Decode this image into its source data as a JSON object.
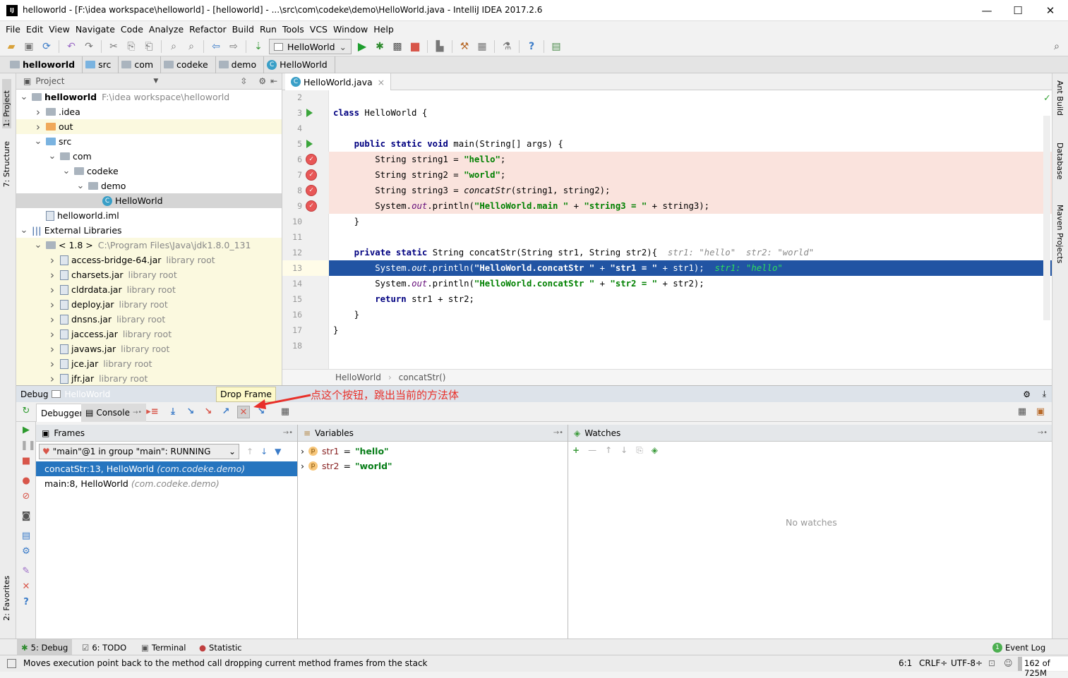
{
  "window": {
    "title": "helloworld - [F:\\idea workspace\\helloworld] - [helloworld] - ...\\src\\com\\codeke\\demo\\HelloWorld.java - IntelliJ IDEA 2017.2.6",
    "logo": "IJ",
    "minimize": "—",
    "maximize": "☐",
    "close": "✕"
  },
  "menu": [
    "File",
    "Edit",
    "View",
    "Navigate",
    "Code",
    "Analyze",
    "Refactor",
    "Build",
    "Run",
    "Tools",
    "VCS",
    "Window",
    "Help"
  ],
  "toolbar": {
    "run_config": "HelloWorld"
  },
  "breadcrumb": [
    "helloworld",
    "src",
    "com",
    "codeke",
    "demo",
    "HelloWorld"
  ],
  "left_tabs": {
    "project": "1: Project",
    "structure": "7: Structure",
    "favorites": "2: Favorites"
  },
  "right_tabs": {
    "ant": "Ant Build",
    "database": "Database",
    "maven": "Maven Projects"
  },
  "project": {
    "title": "Project",
    "tree": [
      {
        "level": 0,
        "arrow": "open",
        "icon": "module",
        "label": "helloworld",
        "secondary": "F:\\idea workspace\\helloworld",
        "bold": true
      },
      {
        "level": 1,
        "arrow": "closed",
        "icon": "folder",
        "label": ".idea"
      },
      {
        "level": 1,
        "arrow": "closed",
        "icon": "folder-orange",
        "label": "out",
        "excluded": true
      },
      {
        "level": 1,
        "arrow": "open",
        "icon": "folder-blue",
        "label": "src"
      },
      {
        "level": 2,
        "arrow": "open",
        "icon": "package",
        "label": "com"
      },
      {
        "level": 3,
        "arrow": "open",
        "icon": "package",
        "label": "codeke"
      },
      {
        "level": 4,
        "arrow": "open",
        "icon": "package",
        "label": "demo"
      },
      {
        "level": 5,
        "arrow": "",
        "icon": "class",
        "label": "HelloWorld",
        "selected": true
      },
      {
        "level": 1,
        "arrow": "",
        "icon": "iml",
        "label": "helloworld.iml"
      },
      {
        "level": 0,
        "arrow": "open",
        "icon": "libraries",
        "label": "External Libraries"
      },
      {
        "level": 1,
        "arrow": "open",
        "icon": "jdk",
        "label": "< 1.8 >",
        "secondary": "C:\\Program Files\\Java\\jdk1.8.0_131",
        "excluded": true
      },
      {
        "level": 2,
        "arrow": "closed",
        "icon": "jar",
        "label": "access-bridge-64.jar",
        "secondary": "library root",
        "excluded": true
      },
      {
        "level": 2,
        "arrow": "closed",
        "icon": "jar",
        "label": "charsets.jar",
        "secondary": "library root",
        "excluded": true
      },
      {
        "level": 2,
        "arrow": "closed",
        "icon": "jar",
        "label": "cldrdata.jar",
        "secondary": "library root",
        "excluded": true
      },
      {
        "level": 2,
        "arrow": "closed",
        "icon": "jar",
        "label": "deploy.jar",
        "secondary": "library root",
        "excluded": true
      },
      {
        "level": 2,
        "arrow": "closed",
        "icon": "jar",
        "label": "dnsns.jar",
        "secondary": "library root",
        "excluded": true
      },
      {
        "level": 2,
        "arrow": "closed",
        "icon": "jar",
        "label": "jaccess.jar",
        "secondary": "library root",
        "excluded": true
      },
      {
        "level": 2,
        "arrow": "closed",
        "icon": "jar",
        "label": "javaws.jar",
        "secondary": "library root",
        "excluded": true
      },
      {
        "level": 2,
        "arrow": "closed",
        "icon": "jar",
        "label": "jce.jar",
        "secondary": "library root",
        "excluded": true
      },
      {
        "level": 2,
        "arrow": "closed",
        "icon": "jar",
        "label": "jfr.jar",
        "secondary": "library root",
        "excluded": true
      }
    ]
  },
  "editor": {
    "tab": "HelloWorld.java",
    "lines": [
      {
        "n": "2",
        "seg": []
      },
      {
        "n": "3",
        "mark": "run",
        "seg": [
          [
            "class ",
            "kw"
          ],
          [
            "HelloWorld {",
            ""
          ]
        ]
      },
      {
        "n": "4",
        "seg": []
      },
      {
        "n": "5",
        "mark": "run",
        "seg": [
          [
            "    "
          ],
          [
            "public static void ",
            "kw"
          ],
          [
            "main(String[] args) {",
            ""
          ]
        ]
      },
      {
        "n": "6",
        "mark": "bp",
        "seg": [
          [
            "        String string1 = ",
            ""
          ],
          [
            "\"hello\"",
            "str"
          ],
          [
            ";",
            ""
          ]
        ]
      },
      {
        "n": "7",
        "mark": "bp",
        "seg": [
          [
            "        String string2 = ",
            ""
          ],
          [
            "\"world\"",
            "str"
          ],
          [
            ";",
            ""
          ]
        ]
      },
      {
        "n": "8",
        "mark": "bp",
        "seg": [
          [
            "        String string3 = ",
            ""
          ],
          [
            "concatStr",
            "itb"
          ],
          [
            "(string1, string2);",
            ""
          ]
        ]
      },
      {
        "n": "9",
        "mark": "bp",
        "seg": [
          [
            "        System.",
            ""
          ],
          [
            "out",
            "it"
          ],
          [
            ".println(",
            ""
          ],
          [
            "\"HelloWorld.main \"",
            "str"
          ],
          [
            " + ",
            ""
          ],
          [
            "\"string3 = \"",
            "str"
          ],
          [
            " + string3);",
            ""
          ]
        ]
      },
      {
        "n": "10",
        "seg": [
          [
            "    }",
            ""
          ]
        ]
      },
      {
        "n": "11",
        "seg": []
      },
      {
        "n": "12",
        "seg": [
          [
            "    "
          ],
          [
            "private static ",
            "kw"
          ],
          [
            "String concatStr(String str1, String str2){",
            ""
          ],
          [
            "  str1: \"hello\"  str2: \"world\"",
            "hint"
          ]
        ]
      },
      {
        "n": "13",
        "current": true,
        "seg": [
          [
            "        System.",
            ""
          ],
          [
            "out",
            "it"
          ],
          [
            ".println(",
            ""
          ],
          [
            "\"HelloWorld.concatStr \"",
            "str"
          ],
          [
            " + ",
            ""
          ],
          [
            "\"str1 = \"",
            "str"
          ],
          [
            " + str1);",
            ""
          ],
          [
            "  str1: \"hello\"",
            "hintg"
          ]
        ]
      },
      {
        "n": "14",
        "seg": [
          [
            "        System.",
            ""
          ],
          [
            "out",
            "it"
          ],
          [
            ".println(",
            ""
          ],
          [
            "\"HelloWorld.concatStr \"",
            "str"
          ],
          [
            " + ",
            ""
          ],
          [
            "\"str2 = \"",
            "str"
          ],
          [
            " + str2);",
            ""
          ]
        ]
      },
      {
        "n": "15",
        "seg": [
          [
            "        "
          ],
          [
            "return ",
            "kw"
          ],
          [
            "str1 + str2;",
            ""
          ]
        ]
      },
      {
        "n": "16",
        "seg": [
          [
            "    }",
            ""
          ]
        ]
      },
      {
        "n": "17",
        "seg": [
          [
            "}",
            ""
          ]
        ]
      },
      {
        "n": "18",
        "seg": []
      }
    ],
    "breadcrumb": [
      "HelloWorld",
      "concatStr()"
    ]
  },
  "debug": {
    "label": "Debug",
    "config": "HelloWorld",
    "tabs": {
      "debugger": "Debugger",
      "console": "Console"
    },
    "tooltip": "Drop Frame",
    "annotation": "点这个按钮，跳出当前的方法体",
    "frames": {
      "title": "Frames",
      "thread": "\"main\"@1 in group \"main\": RUNNING",
      "items": [
        {
          "method": "concatStr:13, HelloWorld",
          "pkg": "(com.codeke.demo)",
          "selected": true
        },
        {
          "method": "main:8, HelloWorld",
          "pkg": "(com.codeke.demo)"
        }
      ]
    },
    "variables": {
      "title": "Variables",
      "items": [
        {
          "name": "str1",
          "value": "\"hello\""
        },
        {
          "name": "str2",
          "value": "\"world\""
        }
      ]
    },
    "watches": {
      "title": "Watches",
      "empty": "No watches"
    }
  },
  "bottom_tabs": [
    {
      "label": "5: Debug",
      "icon": "bug-icon"
    },
    {
      "label": "6: TODO",
      "icon": "todo-icon"
    },
    {
      "label": "Terminal",
      "icon": "terminal-icon"
    },
    {
      "label": "Statistic",
      "icon": "statistic-icon"
    }
  ],
  "event_log": {
    "count": "1",
    "label": "Event Log"
  },
  "status": {
    "message": "Moves execution point back to the method call dropping current method frames from the stack",
    "position": "6:1",
    "line_sep": "CRLF÷",
    "encoding": "UTF-8÷",
    "memory": "162 of 725M"
  },
  "colors": {
    "accent": "#2675bf",
    "current_line": "#2154a3",
    "breakpoint_line": "#fae3dd",
    "annotation": "#e8302a"
  }
}
